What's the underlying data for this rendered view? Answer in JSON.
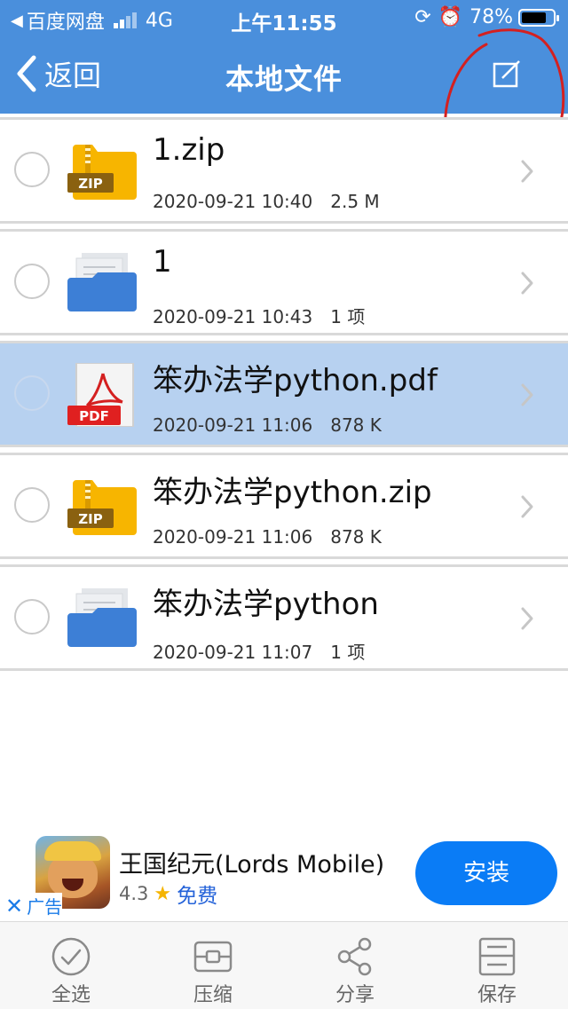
{
  "status_bar": {
    "carrier": "百度网盘",
    "network": "4G",
    "time": "上午11:55",
    "battery": "78%"
  },
  "nav": {
    "back_label": "返回",
    "title": "本地文件"
  },
  "files": [
    {
      "name": "1.zip",
      "date": "2020-09-21 10:40",
      "info": "2.5 M",
      "type": "zip",
      "badge": "ZIP",
      "selected": false
    },
    {
      "name": "1",
      "date": "2020-09-21 10:43",
      "info": "1 项",
      "type": "folder",
      "badge": "",
      "selected": false
    },
    {
      "name": "笨办法学python.pdf",
      "date": "2020-09-21 11:06",
      "info": "878 K",
      "type": "pdf",
      "badge": "PDF",
      "selected": true
    },
    {
      "name": "笨办法学python.zip",
      "date": "2020-09-21 11:06",
      "info": "878 K",
      "type": "zip",
      "badge": "ZIP",
      "selected": false
    },
    {
      "name": "笨办法学python",
      "date": "2020-09-21 11:07",
      "info": "1 项",
      "type": "folder",
      "badge": "",
      "selected": false
    }
  ],
  "ad": {
    "title": "王国纪元(Lords Mobile)",
    "rating": "4.3",
    "price": "免费",
    "label": "广告",
    "install_label": "安装"
  },
  "toolbar": {
    "select_all": "全选",
    "compress": "压缩",
    "share": "分享",
    "save": "保存"
  },
  "colors": {
    "header": "#4a8fdc",
    "selected_row": "#b7d1f0",
    "install_button": "#0a7cf6",
    "annotation": "#d42020",
    "zip_folder": "#f7b500",
    "folder_blue": "#3d7fd6"
  }
}
